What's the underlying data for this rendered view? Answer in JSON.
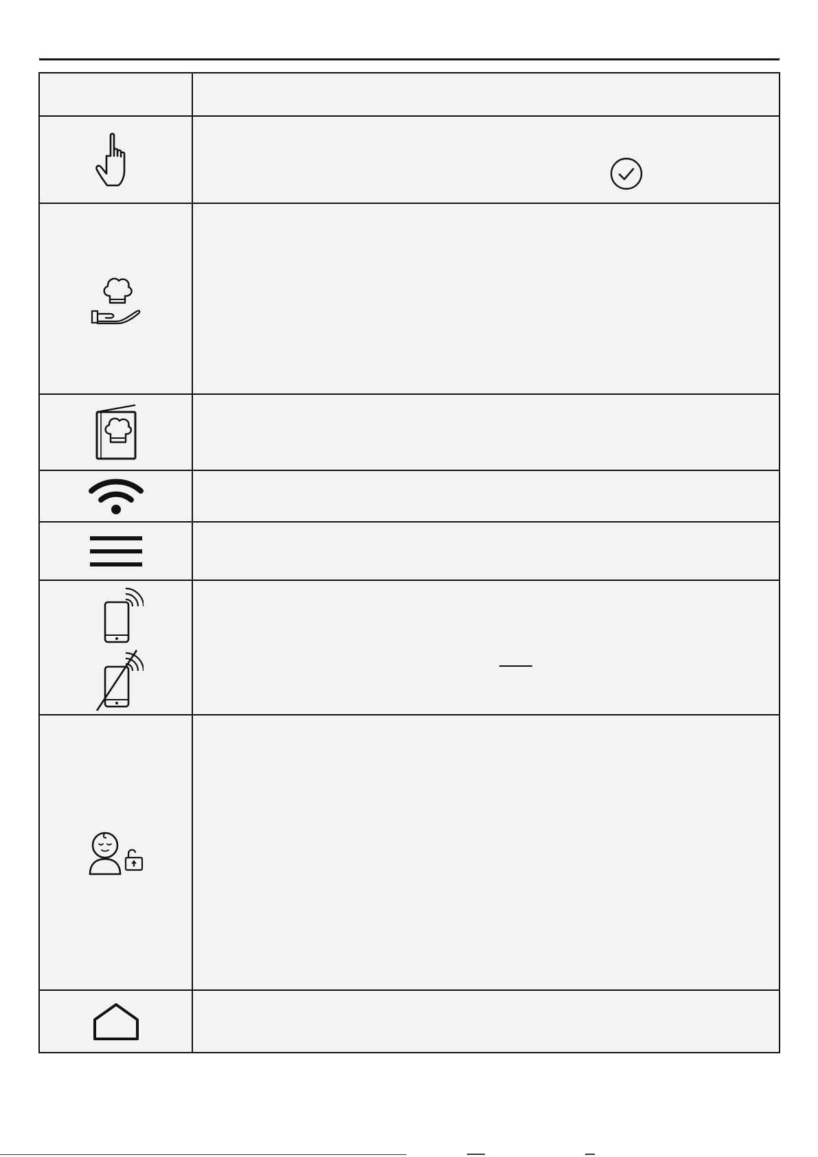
{
  "table": {
    "header": {
      "symbol": "",
      "description": ""
    },
    "rows": [
      {
        "icon": "pointing-hand-icon",
        "text": "",
        "extra_icon": "check-circle-icon"
      },
      {
        "icon": "chef-hat-in-hand-icon",
        "text": ""
      },
      {
        "icon": "recipe-book-icon",
        "text": ""
      },
      {
        "icon": "wifi-icon",
        "text": ""
      },
      {
        "icon": "menu-icon",
        "text": ""
      },
      {
        "icon": "remote-control-on-off-icon",
        "text": ""
      },
      {
        "icon": "child-lock-icon",
        "text": ""
      },
      {
        "icon": "home-icon",
        "text": ""
      }
    ]
  }
}
